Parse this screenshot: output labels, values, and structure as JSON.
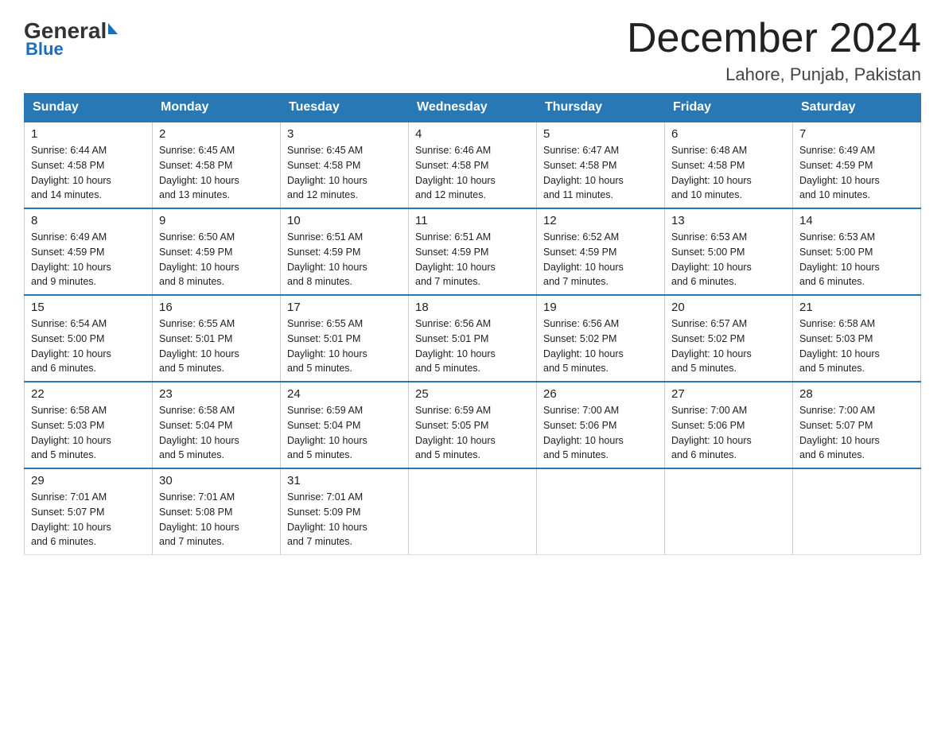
{
  "header": {
    "logo_general": "General",
    "logo_blue": "Blue",
    "title": "December 2024",
    "subtitle": "Lahore, Punjab, Pakistan"
  },
  "weekdays": [
    "Sunday",
    "Monday",
    "Tuesday",
    "Wednesday",
    "Thursday",
    "Friday",
    "Saturday"
  ],
  "weeks": [
    [
      {
        "day": "1",
        "sunrise": "6:44 AM",
        "sunset": "4:58 PM",
        "daylight": "10 hours and 14 minutes."
      },
      {
        "day": "2",
        "sunrise": "6:45 AM",
        "sunset": "4:58 PM",
        "daylight": "10 hours and 13 minutes."
      },
      {
        "day": "3",
        "sunrise": "6:45 AM",
        "sunset": "4:58 PM",
        "daylight": "10 hours and 12 minutes."
      },
      {
        "day": "4",
        "sunrise": "6:46 AM",
        "sunset": "4:58 PM",
        "daylight": "10 hours and 12 minutes."
      },
      {
        "day": "5",
        "sunrise": "6:47 AM",
        "sunset": "4:58 PM",
        "daylight": "10 hours and 11 minutes."
      },
      {
        "day": "6",
        "sunrise": "6:48 AM",
        "sunset": "4:58 PM",
        "daylight": "10 hours and 10 minutes."
      },
      {
        "day": "7",
        "sunrise": "6:49 AM",
        "sunset": "4:59 PM",
        "daylight": "10 hours and 10 minutes."
      }
    ],
    [
      {
        "day": "8",
        "sunrise": "6:49 AM",
        "sunset": "4:59 PM",
        "daylight": "10 hours and 9 minutes."
      },
      {
        "day": "9",
        "sunrise": "6:50 AM",
        "sunset": "4:59 PM",
        "daylight": "10 hours and 8 minutes."
      },
      {
        "day": "10",
        "sunrise": "6:51 AM",
        "sunset": "4:59 PM",
        "daylight": "10 hours and 8 minutes."
      },
      {
        "day": "11",
        "sunrise": "6:51 AM",
        "sunset": "4:59 PM",
        "daylight": "10 hours and 7 minutes."
      },
      {
        "day": "12",
        "sunrise": "6:52 AM",
        "sunset": "4:59 PM",
        "daylight": "10 hours and 7 minutes."
      },
      {
        "day": "13",
        "sunrise": "6:53 AM",
        "sunset": "5:00 PM",
        "daylight": "10 hours and 6 minutes."
      },
      {
        "day": "14",
        "sunrise": "6:53 AM",
        "sunset": "5:00 PM",
        "daylight": "10 hours and 6 minutes."
      }
    ],
    [
      {
        "day": "15",
        "sunrise": "6:54 AM",
        "sunset": "5:00 PM",
        "daylight": "10 hours and 6 minutes."
      },
      {
        "day": "16",
        "sunrise": "6:55 AM",
        "sunset": "5:01 PM",
        "daylight": "10 hours and 5 minutes."
      },
      {
        "day": "17",
        "sunrise": "6:55 AM",
        "sunset": "5:01 PM",
        "daylight": "10 hours and 5 minutes."
      },
      {
        "day": "18",
        "sunrise": "6:56 AM",
        "sunset": "5:01 PM",
        "daylight": "10 hours and 5 minutes."
      },
      {
        "day": "19",
        "sunrise": "6:56 AM",
        "sunset": "5:02 PM",
        "daylight": "10 hours and 5 minutes."
      },
      {
        "day": "20",
        "sunrise": "6:57 AM",
        "sunset": "5:02 PM",
        "daylight": "10 hours and 5 minutes."
      },
      {
        "day": "21",
        "sunrise": "6:58 AM",
        "sunset": "5:03 PM",
        "daylight": "10 hours and 5 minutes."
      }
    ],
    [
      {
        "day": "22",
        "sunrise": "6:58 AM",
        "sunset": "5:03 PM",
        "daylight": "10 hours and 5 minutes."
      },
      {
        "day": "23",
        "sunrise": "6:58 AM",
        "sunset": "5:04 PM",
        "daylight": "10 hours and 5 minutes."
      },
      {
        "day": "24",
        "sunrise": "6:59 AM",
        "sunset": "5:04 PM",
        "daylight": "10 hours and 5 minutes."
      },
      {
        "day": "25",
        "sunrise": "6:59 AM",
        "sunset": "5:05 PM",
        "daylight": "10 hours and 5 minutes."
      },
      {
        "day": "26",
        "sunrise": "7:00 AM",
        "sunset": "5:06 PM",
        "daylight": "10 hours and 5 minutes."
      },
      {
        "day": "27",
        "sunrise": "7:00 AM",
        "sunset": "5:06 PM",
        "daylight": "10 hours and 6 minutes."
      },
      {
        "day": "28",
        "sunrise": "7:00 AM",
        "sunset": "5:07 PM",
        "daylight": "10 hours and 6 minutes."
      }
    ],
    [
      {
        "day": "29",
        "sunrise": "7:01 AM",
        "sunset": "5:07 PM",
        "daylight": "10 hours and 6 minutes."
      },
      {
        "day": "30",
        "sunrise": "7:01 AM",
        "sunset": "5:08 PM",
        "daylight": "10 hours and 7 minutes."
      },
      {
        "day": "31",
        "sunrise": "7:01 AM",
        "sunset": "5:09 PM",
        "daylight": "10 hours and 7 minutes."
      },
      null,
      null,
      null,
      null
    ]
  ],
  "labels": {
    "sunrise": "Sunrise:",
    "sunset": "Sunset:",
    "daylight": "Daylight:"
  }
}
